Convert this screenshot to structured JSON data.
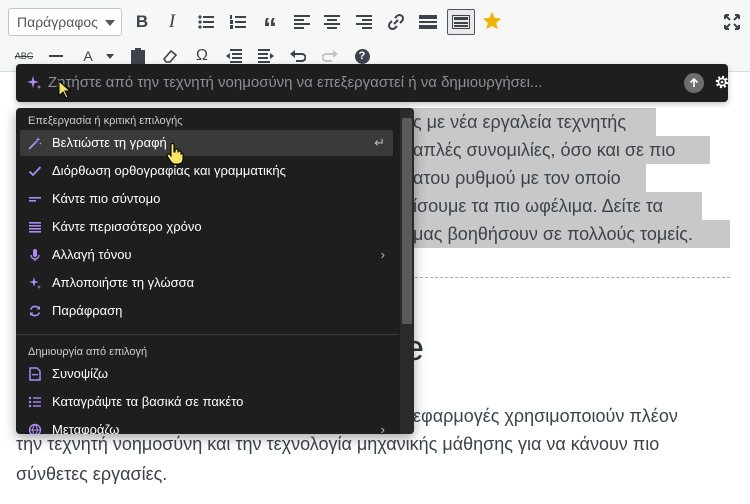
{
  "toolbar": {
    "format_select": "Παράγραφος",
    "row1_icons": [
      "bold-icon",
      "italic-icon",
      "bullet-list-icon",
      "numbered-list-icon",
      "blockquote-icon",
      "align-left-icon",
      "align-center-icon",
      "align-right-icon",
      "link-icon",
      "read-more-icon",
      "toolbar-toggle-icon",
      "star-icon",
      "fullscreen-icon"
    ],
    "row2_icons": [
      "strikethrough-icon",
      "horizontal-rule-icon",
      "text-color-icon",
      "paste-text-icon",
      "clear-formatting-icon",
      "special-character-icon",
      "outdent-icon",
      "indent-icon",
      "undo-icon",
      "redo-icon",
      "help-icon"
    ],
    "bold": "B",
    "italic": "I",
    "strike": "ABC",
    "text_color": "A",
    "omega": "Ω",
    "quote": "“",
    "help": "?"
  },
  "editor": {
    "lines_top": [
      "ς με νέα εργαλεία τεχνητής",
      "απλές συνομιλίες, όσο και σε πιο",
      "ατου ρυθμού με τον οποίο",
      "ίσουμε τα πιο ωφέλιμα. Δείτε τα",
      "μας βοηθήσουν σε πολλούς τομείς."
    ],
    "heading_fragment": "e",
    "lines_bottom": [
      "εφαρμογές χρησιμοποιούν πλέον",
      "την τεχνητή νοημοσύνη και την τεχνολογία μηχανικής μάθησης για να κάνουν πιο",
      "σύνθετες εργασίες."
    ]
  },
  "ai_bar": {
    "placeholder": "Ζητήστε από την τεχνητή νοημοσύνη να επεξεργαστεί ή να δημιουργήσει..."
  },
  "menu": {
    "section1_title": "Επεξεργασία ή κριτική επιλογής",
    "section1_items": [
      {
        "label": "Βελτιώστε τη γραφή",
        "icon": "magic-wand-icon",
        "right": "↵"
      },
      {
        "label": "Διόρθωση ορθογραφίας και γραμματικής",
        "icon": "check-icon",
        "right": ""
      },
      {
        "label": "Κάντε πιο σύντομο",
        "icon": "short-lines-icon",
        "right": ""
      },
      {
        "label": "Κάντε περισσότερο χρόνο",
        "icon": "long-lines-icon",
        "right": ""
      },
      {
        "label": "Αλλαγή τόνου",
        "icon": "microphone-icon",
        "right": "›"
      },
      {
        "label": "Απλοποιήστε τη γλώσσα",
        "icon": "sparkle-icon",
        "right": ""
      },
      {
        "label": "Παράφραση",
        "icon": "refresh-icon",
        "right": ""
      }
    ],
    "section2_title": "Δημιουργία από επιλογή",
    "section2_items": [
      {
        "label": "Συνοψίζω",
        "icon": "document-icon",
        "right": ""
      },
      {
        "label": "Καταγράψτε τα βασικά σε πακέτο",
        "icon": "list-icon",
        "right": ""
      },
      {
        "label": "Μεταφράζω",
        "icon": "globe-icon",
        "right": "›"
      }
    ]
  },
  "colors": {
    "accent": "#a98ef5",
    "menu_bg": "#1e1e1e",
    "selection": "#c8c8c8",
    "star": "#f0b400"
  }
}
